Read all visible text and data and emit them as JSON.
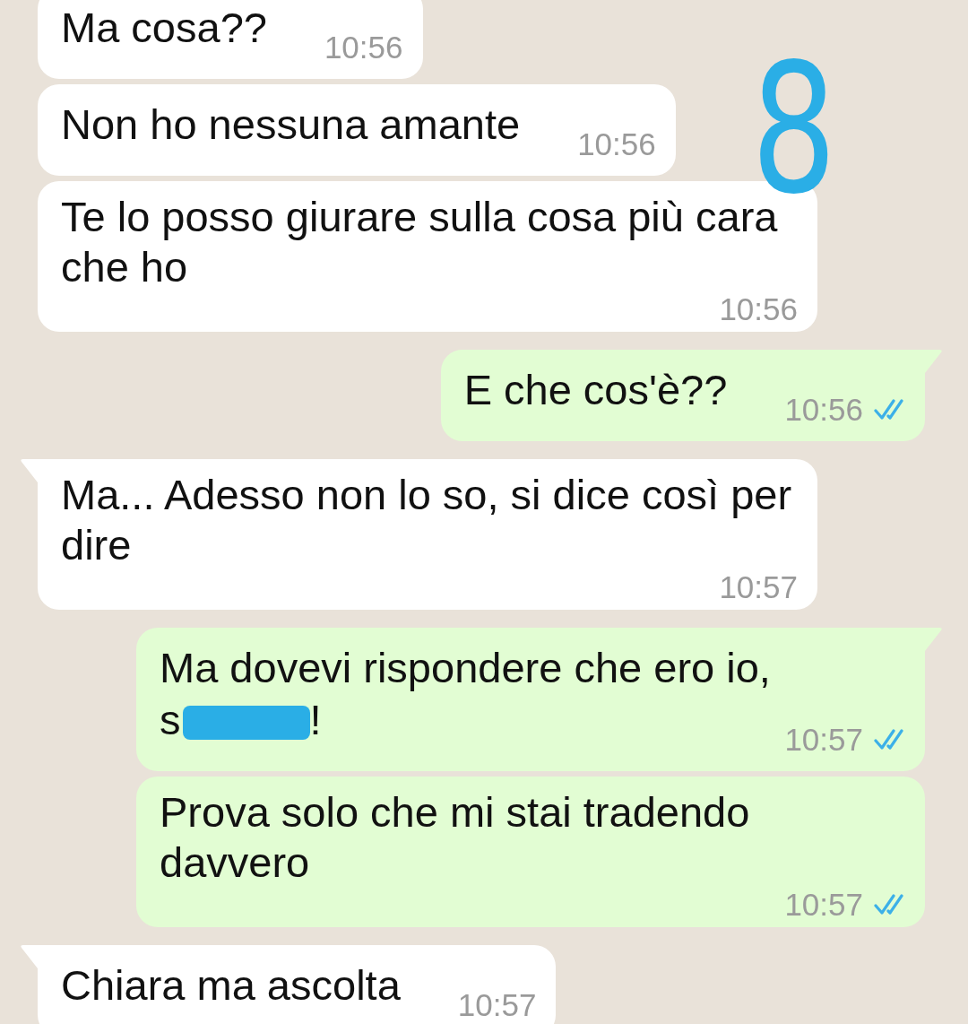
{
  "messages": [
    {
      "kind": "incoming",
      "tail": false,
      "lines": [
        "Ma cosa??"
      ],
      "time": "10:56"
    },
    {
      "kind": "incoming",
      "tail": false,
      "lines": [
        "Non ho nessuna amante"
      ],
      "time": "10:56"
    },
    {
      "kind": "incoming",
      "tail": false,
      "lines": [
        "Te lo posso giurare sulla cosa più cara",
        "che ho"
      ],
      "time": "10:56"
    },
    {
      "kind": "outgoing",
      "tail": true,
      "lines": [
        "E che cos'è??"
      ],
      "time": "10:56",
      "read": true
    },
    {
      "kind": "incoming",
      "tail": true,
      "lines": [
        "Ma... Adesso non lo so, si dice così per",
        "dire"
      ],
      "time": "10:57"
    },
    {
      "kind": "outgoing",
      "tail": true,
      "lines": [
        "Ma dovevi rispondere che ero io,",
        "s"
      ],
      "redacted": true,
      "after_redaction": "!",
      "time": "10:57",
      "read": true
    },
    {
      "kind": "outgoing",
      "tail": false,
      "lines": [
        "Prova solo che mi stai tradendo",
        "davvero"
      ],
      "time": "10:57",
      "read": true
    },
    {
      "kind": "incoming",
      "tail": true,
      "lines": [
        "Chiara ma ascolta"
      ],
      "time": "10:57"
    }
  ],
  "annotation": {
    "text": "8"
  }
}
